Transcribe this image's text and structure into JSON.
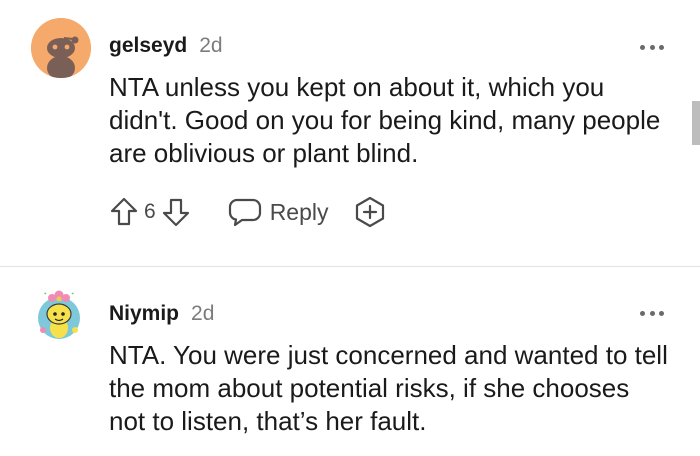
{
  "comments": [
    {
      "username": "gelseyd",
      "age": "2d",
      "text": "NTA unless you kept on about it, which you didn't. Good on you for being kind, many people are oblivious or plant blind.",
      "score": "6",
      "reply_label": "Reply"
    },
    {
      "username": "Niymip",
      "age": "2d",
      "text": "NTA. You were just concerned and wanted to tell the mom about potential risks, if she chooses not to listen, that’s her fault."
    }
  ],
  "icons": {
    "more": "more-options-icon",
    "upvote": "upvote-arrow-icon",
    "downvote": "downvote-arrow-icon",
    "reply": "speech-bubble-icon",
    "award": "award-plus-icon"
  },
  "colors": {
    "avatar1_bg": "#f5a96a",
    "text": "#1a1a1b",
    "muted": "#7c7c7c",
    "divider": "#e3e3e3"
  }
}
